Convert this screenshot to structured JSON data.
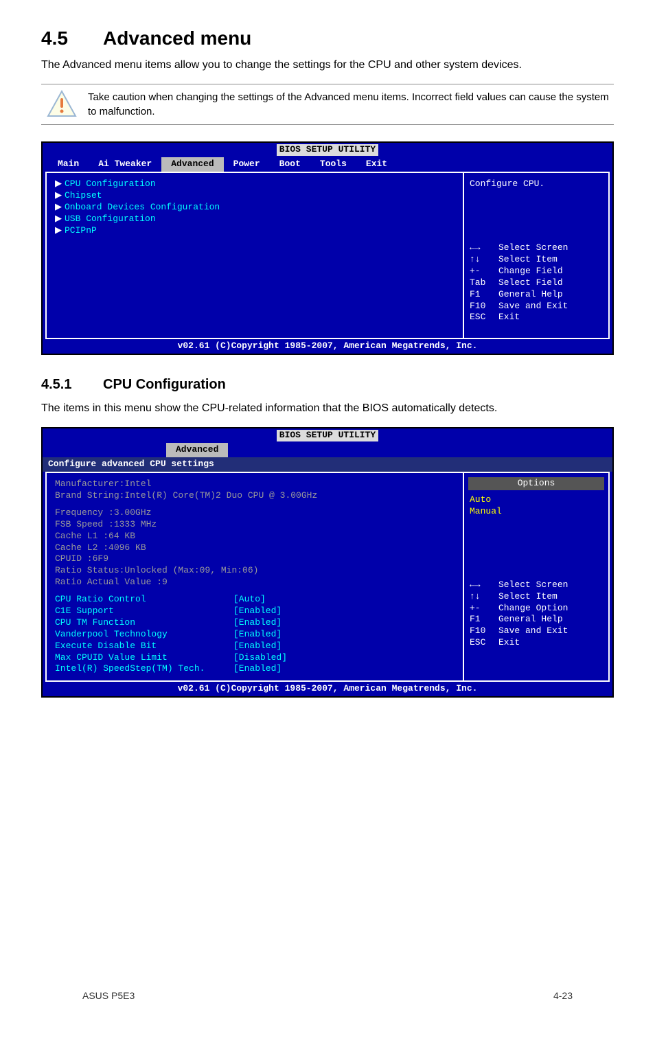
{
  "section": {
    "number": "4.5",
    "title": "Advanced menu"
  },
  "intro": "The Advanced menu items allow you to change the settings for the CPU and other system devices.",
  "caution": "Take caution when changing the settings of the Advanced menu items. Incorrect field values can cause the system to malfunction.",
  "bios1": {
    "title": "BIOS SETUP UTILITY",
    "tabs": [
      "Main",
      "Ai Tweaker",
      "Advanced",
      "Power",
      "Boot",
      "Tools",
      "Exit"
    ],
    "active_tab": "Advanced",
    "menu": [
      "CPU Configuration",
      "Chipset",
      "Onboard Devices Configuration",
      "USB Configuration",
      "PCIPnP"
    ],
    "help_title": "Configure CPU.",
    "help": [
      {
        "key": "←→",
        "text": "Select Screen",
        "icon": "lr"
      },
      {
        "key": "↑↓",
        "text": "Select Item",
        "icon": "ud"
      },
      {
        "key": "+-",
        "text": "Change Field"
      },
      {
        "key": "Tab",
        "text": "Select Field"
      },
      {
        "key": "F1",
        "text": "General Help"
      },
      {
        "key": "F10",
        "text": "Save and Exit"
      },
      {
        "key": "ESC",
        "text": "Exit"
      }
    ],
    "copyright": "v02.61 (C)Copyright 1985-2007, American Megatrends, Inc."
  },
  "sub": {
    "number": "4.5.1",
    "title": "CPU Configuration"
  },
  "sub_text": "The items in this menu show the CPU-related information that the BIOS automatically detects.",
  "bios2": {
    "title": "BIOS SETUP UTILITY",
    "active_tab": "Advanced",
    "header": "Configure advanced CPU settings",
    "options_title": "Options",
    "options": [
      "Auto",
      "Manual"
    ],
    "info": [
      "Manufacturer:Intel",
      "Brand String:Intel(R) Core(TM)2 Duo CPU @ 3.00GHz"
    ],
    "specs": [
      "Frequency   :3.00GHz",
      "FSB Speed   :1333 MHz",
      "Cache L1    :64 KB",
      "Cache L2    :4096 KB",
      "CPUID       :6F9",
      "Ratio Status:Unlocked (Max:09, Min:06)",
      "Ratio Actual Value  :9"
    ],
    "settings": [
      {
        "label": "CPU Ratio Control",
        "value": "[Auto]"
      },
      {
        "label": "C1E Support",
        "value": "[Enabled]"
      },
      {
        "label": "CPU TM Function",
        "value": "[Enabled]"
      },
      {
        "label": "Vanderpool Technology",
        "value": "[Enabled]"
      },
      {
        "label": "Execute Disable Bit",
        "value": "[Enabled]"
      },
      {
        "label": "Max CPUID Value Limit",
        "value": "[Disabled]"
      },
      {
        "label": "Intel(R) SpeedStep(TM) Tech.",
        "value": "[Enabled]"
      }
    ],
    "help": [
      {
        "key": "←→",
        "text": "Select Screen",
        "icon": "lr"
      },
      {
        "key": "↑↓",
        "text": "Select Item",
        "icon": "ud"
      },
      {
        "key": "+-",
        "text": "Change Option"
      },
      {
        "key": "F1",
        "text": "General Help"
      },
      {
        "key": "F10",
        "text": "Save and Exit"
      },
      {
        "key": "ESC",
        "text": "Exit"
      }
    ],
    "copyright": "v02.61 (C)Copyright 1985-2007, American Megatrends, Inc."
  },
  "footer": {
    "left": "ASUS P5E3",
    "right": "4-23"
  }
}
